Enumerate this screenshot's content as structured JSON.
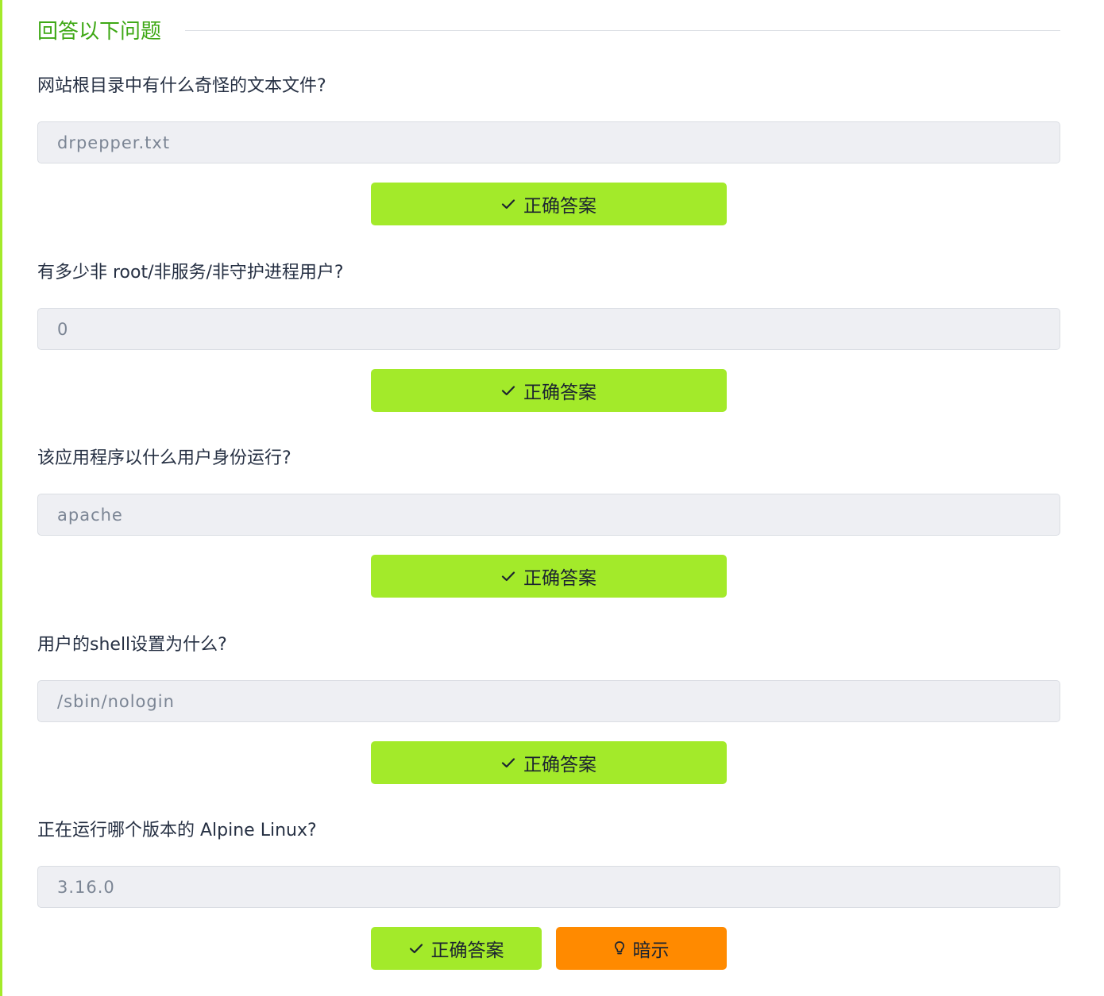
{
  "section": {
    "title": "回答以下问题"
  },
  "questions": [
    {
      "text": "网站根目录中有什么奇怪的文本文件?",
      "answer": "drpepper.txt",
      "button_label": "正确答案"
    },
    {
      "text": "有多少非 root/非服务/非守护进程用户?",
      "answer": "0",
      "button_label": "正确答案"
    },
    {
      "text": "该应用程序以什么用户身份运行?",
      "answer": "apache",
      "button_label": "正确答案"
    },
    {
      "text": "用户的shell设置为什么?",
      "answer": "/sbin/nologin",
      "button_label": "正确答案"
    },
    {
      "text": "正在运行哪个版本的 Alpine Linux?",
      "answer": "3.16.0",
      "button_label": "正确答案",
      "hint_label": "暗示"
    }
  ],
  "colors": {
    "accent_green": "#a3ea2a",
    "title_green": "#3ea815",
    "hint_orange": "#ff8a00",
    "answer_bg": "#eeeff3"
  },
  "icons": {
    "correct": "check-icon",
    "hint": "lightbulb-icon"
  }
}
